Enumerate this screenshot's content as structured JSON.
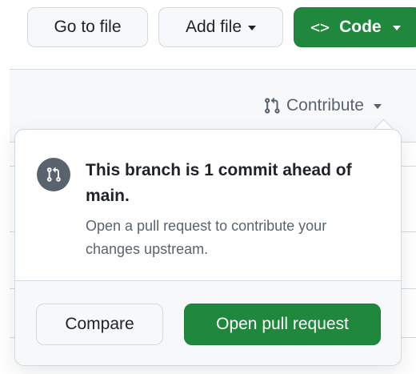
{
  "toolbar": {
    "go_to_file": "Go to file",
    "add_file": "Add file",
    "code": "Code",
    "code_icon": "<>"
  },
  "contribute": {
    "label": "Contribute",
    "icon": "git-pull-request-icon"
  },
  "popover": {
    "icon": "git-pull-request-icon",
    "title": "This branch is 1 commit ahead of main.",
    "description": "Open a pull request to contribute your changes upstream.",
    "compare_button": "Compare",
    "open_pr_button": "Open pull request"
  },
  "colors": {
    "primary_green": "#1f883d",
    "muted_text": "#59636e",
    "border": "#d1d9e0",
    "icon_circle": "#59636e"
  }
}
